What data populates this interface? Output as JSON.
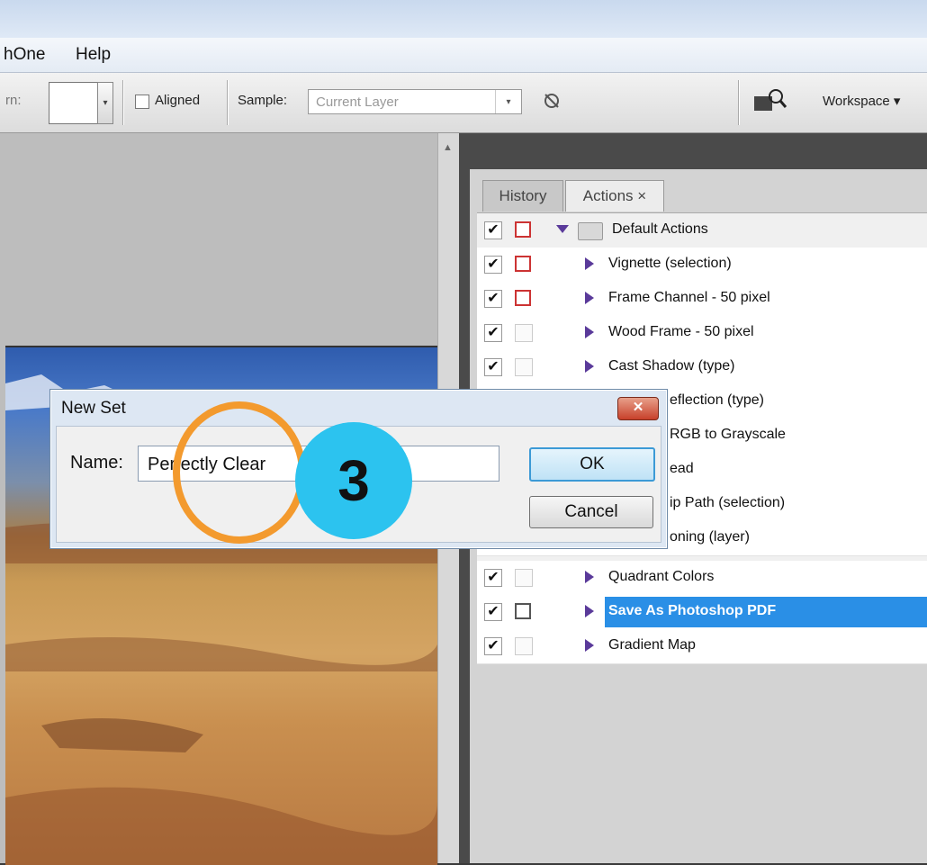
{
  "menubar": {
    "items": [
      "hOne",
      "Help"
    ]
  },
  "options": {
    "pattern_label": "rn:",
    "aligned_label": "Aligned",
    "sample_label": "Sample:",
    "sample_value": "Current Layer",
    "workspace_label": "Workspace ▾"
  },
  "tabs": {
    "history": "History",
    "actions": "Actions ×"
  },
  "actions": [
    {
      "label": "Default Actions",
      "checked": true,
      "dialog": "red"
    },
    {
      "label": "Vignette (selection)",
      "checked": true,
      "dialog": "red"
    },
    {
      "label": "Frame Channel - 50 pixel",
      "checked": true,
      "dialog": "red"
    },
    {
      "label": "Wood Frame - 50 pixel",
      "checked": true,
      "dialog": "none"
    },
    {
      "label": "Cast Shadow (type)",
      "checked": true,
      "dialog": "none"
    },
    {
      "label": "eflection (type)",
      "checked": true,
      "dialog": "none"
    },
    {
      "label": "RGB to Grayscale",
      "checked": true,
      "dialog": "none"
    },
    {
      "label": "ead",
      "checked": true,
      "dialog": "none"
    },
    {
      "label": "ip Path (selection)",
      "checked": true,
      "dialog": "none"
    },
    {
      "label": "oning (layer)",
      "checked": true,
      "dialog": "none"
    },
    {
      "label": "Quadrant Colors",
      "checked": true,
      "dialog": "none"
    },
    {
      "label": "Save As Photoshop PDF",
      "checked": true,
      "dialog": "dialog",
      "selected": true
    },
    {
      "label": "Gradient Map",
      "checked": true,
      "dialog": "none"
    }
  ],
  "dialog": {
    "title": "New Set",
    "close": "✕",
    "name_label": "Name:",
    "name_value": "Perfectly Clear",
    "ok": "OK",
    "cancel": "Cancel"
  },
  "badge": "3",
  "colors": {
    "highlight": "#2a8fe6",
    "badge": "#2cc3ef",
    "annotation": "#f39a2e"
  }
}
